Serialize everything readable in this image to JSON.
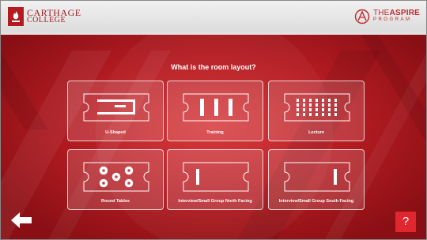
{
  "header": {
    "left_logo": {
      "line1": "CARTHAGE",
      "line2": "COLLEGE",
      "icon": "flame-seal-icon"
    },
    "right_logo": {
      "line1_thin": "THE",
      "line1_bold": "ASPIRE",
      "line2": "PROGRAM",
      "icon": "aspire-a-icon"
    }
  },
  "prompt": "What is the room layout?",
  "options": [
    {
      "label": "U-Shaped",
      "icon": "u-shaped-layout-icon"
    },
    {
      "label": "Training",
      "icon": "training-layout-icon"
    },
    {
      "label": "Lecture",
      "icon": "lecture-layout-icon"
    },
    {
      "label": "Round Tables",
      "icon": "round-tables-layout-icon"
    },
    {
      "label": "Interview/Small Group North Facing",
      "icon": "north-facing-layout-icon"
    },
    {
      "label": "Interview/Small Group South Facing",
      "icon": "south-facing-layout-icon"
    }
  ],
  "nav": {
    "back_icon": "arrow-left-icon",
    "help_label": "?"
  },
  "colors": {
    "accent_red": "#c0272d",
    "help_button": "#e0262e",
    "background": "#b41c22"
  }
}
